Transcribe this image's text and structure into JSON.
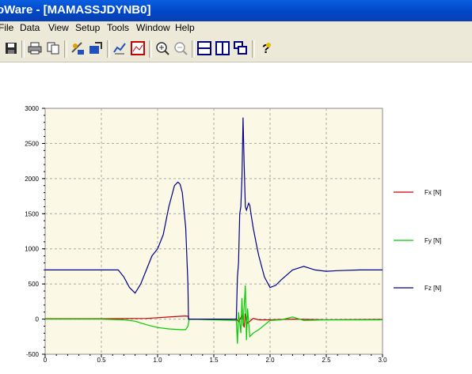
{
  "window": {
    "title": "oWare - [MAMASSJDYNB0]"
  },
  "menu": {
    "items": [
      "File",
      "Data",
      "View",
      "Setup",
      "Tools",
      "Window",
      "Help"
    ]
  },
  "toolbar": {
    "buttons": [
      "save-icon",
      "print-icon",
      "copy-icon",
      "process-icon",
      "export-icon",
      "edit-graph-icon",
      "chart-view-icon",
      "zoom-in-icon",
      "zoom-out-icon",
      "tile-horizontal-icon",
      "tile-vertical-icon",
      "cascade-icon",
      "help-icon"
    ]
  },
  "colors": {
    "fx": "#cc0000",
    "fy": "#00cc00",
    "fz": "#00008b",
    "plot_bg": "#fbf9e6"
  },
  "chart_data": {
    "type": "line",
    "xlim": [
      0,
      3.0
    ],
    "ylim": [
      -500,
      3000
    ],
    "x_ticks": [
      "0",
      "0.5",
      "1.0",
      "1.5",
      "2.0",
      "2.5",
      "3.0"
    ],
    "y_ticks": [
      "-500",
      "0",
      "500",
      "1000",
      "1500",
      "2000",
      "2500",
      "3000"
    ],
    "legend_placement": "right",
    "grid": true,
    "series": [
      {
        "name": "Fx [N]",
        "x": [
          0,
          0.5,
          0.9,
          1.0,
          1.1,
          1.2,
          1.25,
          1.27,
          1.28,
          1.7,
          1.72,
          1.75,
          1.77,
          1.78,
          1.8,
          1.85,
          1.9,
          2.0,
          2.2,
          2.5,
          3.0
        ],
        "y": [
          5,
          5,
          10,
          20,
          30,
          40,
          45,
          40,
          0,
          0,
          -40,
          50,
          -120,
          80,
          -60,
          10,
          -10,
          -10,
          0,
          -10,
          -5
        ]
      },
      {
        "name": "Fy [N]",
        "x": [
          0,
          0.5,
          0.7,
          0.8,
          0.9,
          1.0,
          1.1,
          1.2,
          1.25,
          1.27,
          1.28,
          1.7,
          1.71,
          1.72,
          1.74,
          1.75,
          1.76,
          1.78,
          1.79,
          1.8,
          1.82,
          1.85,
          1.9,
          2.0,
          2.1,
          2.2,
          2.3,
          2.5,
          3.0
        ],
        "y": [
          0,
          0,
          -10,
          -30,
          -80,
          -120,
          -140,
          -150,
          -150,
          -100,
          0,
          -20,
          -350,
          100,
          -200,
          300,
          -100,
          480,
          -300,
          150,
          -250,
          -200,
          -150,
          -20,
          -10,
          30,
          -20,
          -10,
          -10
        ]
      },
      {
        "name": "Fz [N]",
        "x": [
          0,
          0.5,
          0.65,
          0.7,
          0.75,
          0.8,
          0.85,
          0.9,
          0.95,
          1.0,
          1.05,
          1.1,
          1.15,
          1.18,
          1.2,
          1.22,
          1.25,
          1.27,
          1.275,
          1.7,
          1.71,
          1.72,
          1.73,
          1.74,
          1.75,
          1.76,
          1.77,
          1.78,
          1.79,
          1.8,
          1.81,
          1.82,
          1.83,
          1.85,
          1.88,
          1.9,
          1.95,
          2.0,
          2.05,
          2.1,
          2.2,
          2.3,
          2.4,
          2.5,
          2.6,
          2.8,
          3.0
        ],
        "y": [
          700,
          700,
          700,
          600,
          450,
          370,
          500,
          700,
          900,
          1000,
          1200,
          1600,
          1900,
          1950,
          1920,
          1800,
          1300,
          500,
          0,
          0,
          600,
          800,
          1500,
          1600,
          2000,
          2870,
          2200,
          1600,
          1550,
          1600,
          1650,
          1620,
          1500,
          1300,
          1050,
          900,
          600,
          450,
          480,
          560,
          700,
          750,
          700,
          680,
          690,
          700,
          700
        ]
      }
    ]
  }
}
